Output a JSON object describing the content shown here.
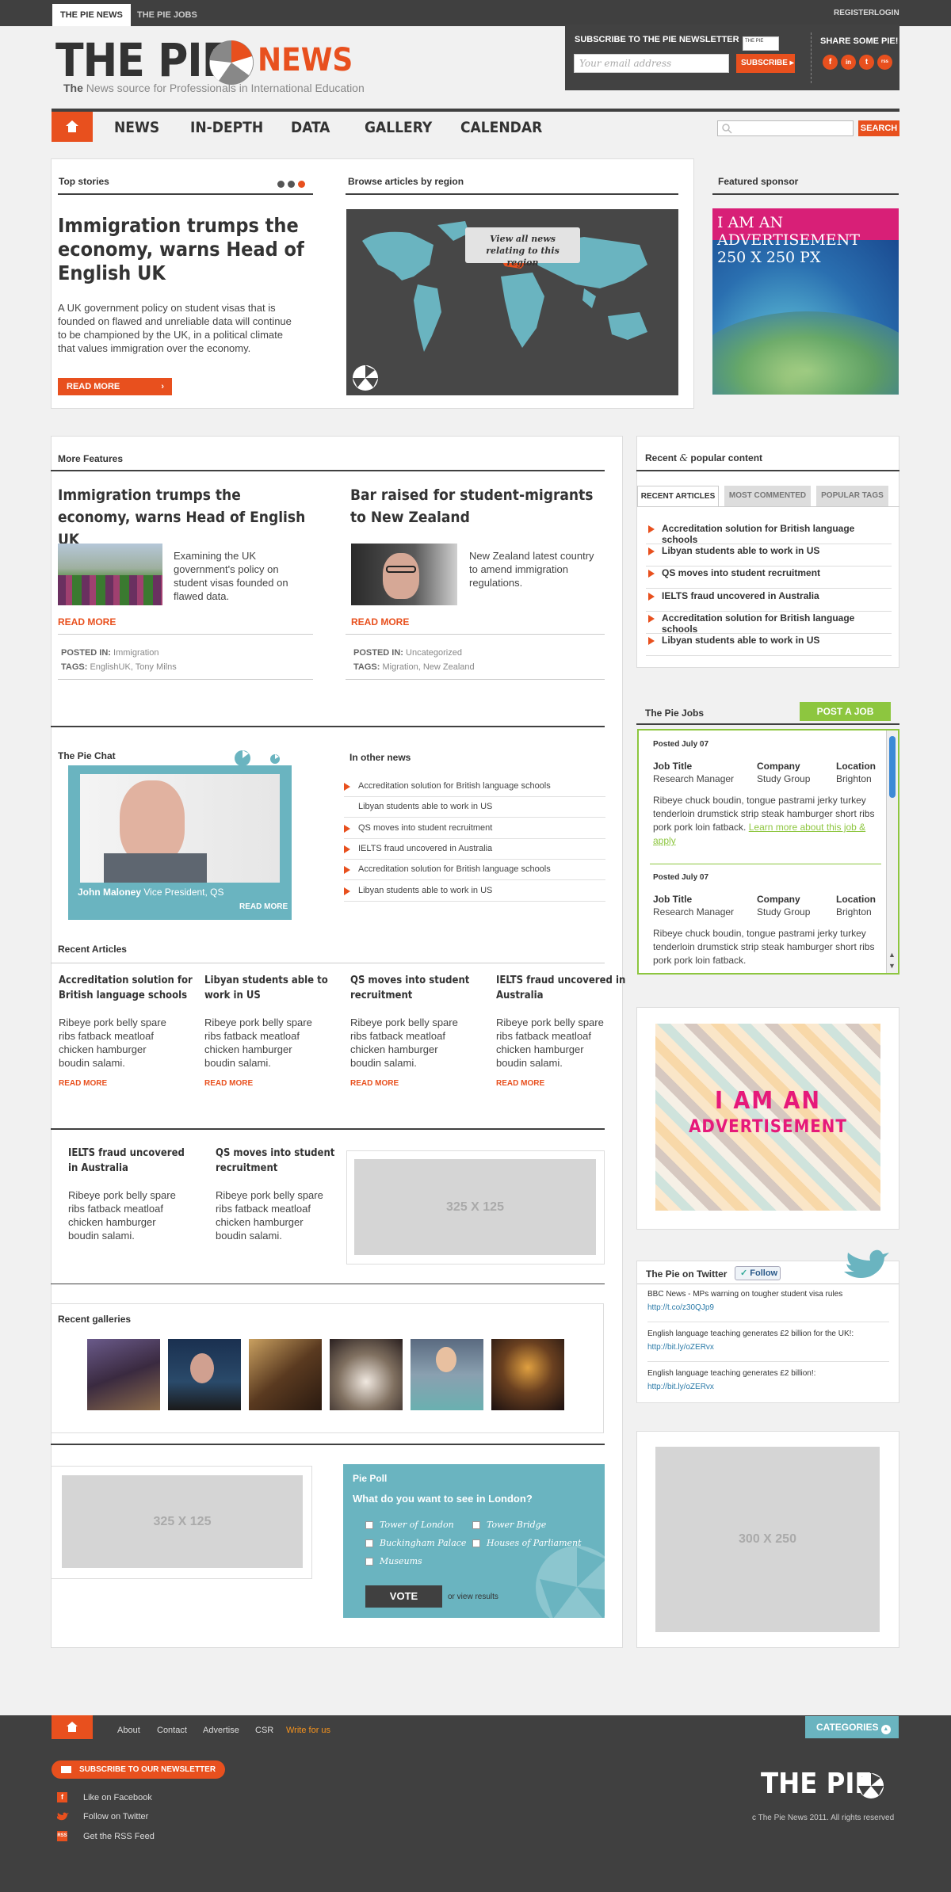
{
  "topbar": {
    "tab_news": "THE PIE NEWS",
    "tab_jobs": "THE PIE JOBS",
    "register": "REGISTER",
    "login": "LOGIN"
  },
  "header": {
    "logo_main": "THE PIE",
    "logo_news": "NEWS",
    "tagline_the": "The",
    "tagline_rest": "News source for Professionals in International Education",
    "newsletter_title": "SUBSCRIBE TO THE PIE NEWSLETTER",
    "email_placeholder": "Your email address",
    "subscribe_label": "SUBSCRIBE",
    "newspaper_label": "THE PIE",
    "share_title": "SHARE SOME PIE!",
    "social": [
      "f",
      "in",
      "t",
      "rss"
    ]
  },
  "nav": {
    "items": [
      "NEWS",
      "IN-DEPTH",
      "DATA",
      "GALLERY",
      "CALENDAR"
    ],
    "search_label": "SEARCH"
  },
  "top_stories": {
    "title": "Top stories",
    "headline": "Immigration trumps the economy, warns Head of English UK",
    "body": "A UK government policy on student visas that is founded on flawed and unreliable data will continue to be championed by the UK, in a political climate that values immigration over the economy.",
    "read_more": "READ MORE"
  },
  "browse": {
    "title": "Browse articles by region",
    "tooltip": "View all news relating to this region"
  },
  "featured_sponsor": {
    "title": "Featured sponsor",
    "ad_text": "I AM AN ADVERTISEMENT 250 X 250 PX"
  },
  "more_features": {
    "title": "More Features",
    "articles": [
      {
        "headline": "Immigration trumps the economy, warns Head of English UK",
        "summary": "Examining the UK government's policy on student visas founded on flawed data.",
        "read_more": "READ MORE",
        "posted_label": "POSTED IN:",
        "posted": "Immigration",
        "tags_label": "TAGS:",
        "tags": "EnglishUK, Tony Milns"
      },
      {
        "headline": "Bar raised for student-migrants to New Zealand",
        "summary": "New Zealand latest country to amend immigration regulations.",
        "read_more": "READ MORE",
        "posted_label": "POSTED IN:",
        "posted": "Uncategorized",
        "tags_label": "TAGS:",
        "tags": "Migration, New Zealand"
      }
    ]
  },
  "recent_popular": {
    "title_a": "Recent",
    "amp": "&",
    "title_b": "popular content",
    "tabs": [
      "RECENT ARTICLES",
      "MOST COMMENTED",
      "POPULAR TAGS"
    ],
    "items": [
      "Accreditation solution for British language schools",
      "Libyan students able to work in US",
      "QS moves into student recruitment",
      "IELTS fraud uncovered in Australia",
      "Accreditation solution for British language schools",
      "Libyan students able to work in US"
    ]
  },
  "pie_chat": {
    "title": "The Pie Chat",
    "name": "John Maloney",
    "role": "Vice President, QS",
    "read_more": "READ MORE"
  },
  "other_news": {
    "title": "In other news",
    "items": [
      "Accreditation solution for British language schools",
      "Libyan students able to work in US",
      "QS moves into student recruitment",
      "IELTS fraud uncovered in Australia",
      "Accreditation solution for British language schools",
      "Libyan students able to work in US"
    ]
  },
  "jobs": {
    "title": "The Pie Jobs",
    "post_label": "POST A JOB",
    "listings": [
      {
        "posted": "Posted July 07",
        "h_title": "Job Title",
        "h_company": "Company",
        "h_location": "Location",
        "title": "Research Manager",
        "company": "Study Group",
        "location": "Brighton",
        "desc": "Ribeye chuck boudin, tongue pastrami jerky turkey tenderloin drumstick strip steak hamburger short ribs pork pork loin fatback.",
        "link": "Learn more about this job & apply"
      },
      {
        "posted": "Posted July 07",
        "h_title": "Job Title",
        "h_company": "Company",
        "h_location": "Location",
        "title": "Research Manager",
        "company": "Study Group",
        "location": "Brighton",
        "desc": "Ribeye chuck boudin, tongue pastrami jerky turkey tenderloin drumstick strip steak hamburger short ribs pork pork loin fatback."
      }
    ]
  },
  "recent_articles": {
    "title": "Recent Articles",
    "items": [
      {
        "title": "Accreditation solution for British language schools",
        "body": "Ribeye pork belly spare ribs fatback meatloaf chicken hamburger boudin salami.",
        "read_more": "READ MORE"
      },
      {
        "title": "Libyan students able to work in US",
        "body": "Ribeye pork belly spare ribs fatback meatloaf chicken hamburger boudin salami.",
        "read_more": "READ MORE"
      },
      {
        "title": "QS moves into student recruitment",
        "body": "Ribeye pork belly spare ribs fatback meatloaf chicken hamburger boudin salami.",
        "read_more": "READ MORE"
      },
      {
        "title": "IELTS fraud uncovered in Australia",
        "body": "Ribeye pork belly spare ribs fatback meatloaf chicken hamburger boudin salami.",
        "read_more": "READ MORE"
      }
    ],
    "second_row": [
      {
        "title": "IELTS fraud uncovered in Australia",
        "body": "Ribeye pork belly spare ribs fatback meatloaf chicken hamburger boudin salami."
      },
      {
        "title": "QS moves into student recruitment",
        "body": "Ribeye pork belly spare ribs fatback meatloaf chicken hamburger boudin salami."
      }
    ],
    "ad_label": "325 X 125"
  },
  "ad_stripes": {
    "line1": "I AM AN",
    "line2": "ADVERTISEMENT"
  },
  "twitter": {
    "title": "The Pie on Twitter",
    "follow": "Follow",
    "tweets": [
      {
        "text": "BBC News - MPs warning on tougher student visa rules",
        "link": "http://t.co/z30QJp9"
      },
      {
        "text": "English language teaching generates £2 billion for the UK!:",
        "link": "http://bit.ly/oZERvx"
      },
      {
        "text": "English language teaching generates £2 billion!:",
        "link": "http://bit.ly/oZERvx"
      }
    ]
  },
  "galleries": {
    "title": "Recent galleries"
  },
  "bottom_ad": {
    "label": "325 X 125"
  },
  "poll": {
    "title": "Pie Poll",
    "question": "What do you want to see in London?",
    "options": [
      "Tower of London",
      "Tower Bridge",
      "Buckingham Palace",
      "Houses of Parliament",
      "Museums"
    ],
    "vote": "VOTE",
    "or_results": "or view results"
  },
  "side_ad": {
    "label": "300 X 250"
  },
  "footer": {
    "links": [
      "About",
      "Contact",
      "Advertise",
      "CSR"
    ],
    "write": "Write for us",
    "categories": "CATEGORIES",
    "newsletter": "SUBSCRIBE TO OUR NEWSLETTER",
    "facebook": "Like on Facebook",
    "twitter": "Follow on Twitter",
    "rss": "Get the RSS Feed",
    "logo": "THE PIE",
    "copyright": "c The Pie News 2011. All rights reserved"
  },
  "colors": {
    "accent": "#e8501e",
    "dark": "#404040",
    "teal": "#6ab4c0",
    "green": "#8dc63f"
  }
}
